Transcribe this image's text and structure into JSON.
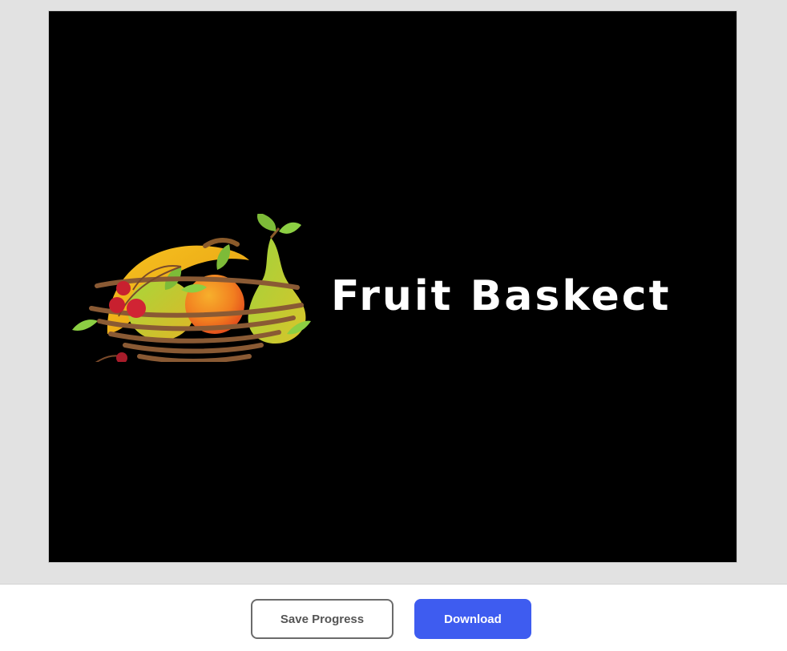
{
  "canvas": {
    "logo_text": "Fruit Baskect",
    "logo_art_icon": "fruit-basket-icon"
  },
  "footer": {
    "save_label": "Save Progress",
    "download_label": "Download"
  },
  "colors": {
    "workspace_bg": "#e2e2e2",
    "canvas_bg": "#000000",
    "primary_button": "#3e5cf0",
    "secondary_border": "#6b6b6b",
    "logo_text": "#ffffff"
  }
}
